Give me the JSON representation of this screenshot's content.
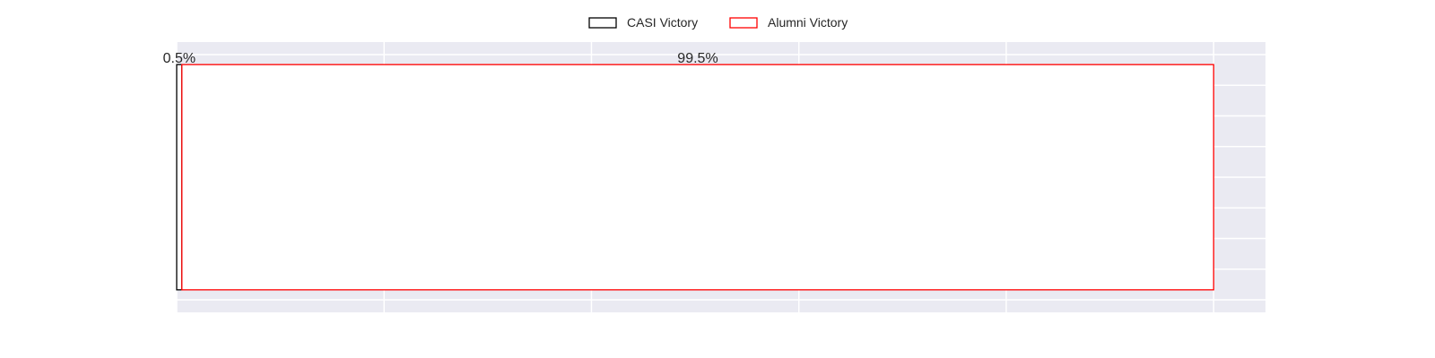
{
  "chart_data": {
    "type": "bar",
    "orientation": "horizontal",
    "stacked": true,
    "categories": [
      ""
    ],
    "series": [
      {
        "name": "CASI Victory",
        "values": [
          0.5
        ],
        "label": "0.5%",
        "edge_color": "#000000",
        "face_color": "#ffffff"
      },
      {
        "name": "Alumni Victory",
        "values": [
          99.5
        ],
        "label": "99.5%",
        "edge_color": "#ff0000",
        "face_color": "#ffffff"
      }
    ],
    "title": "",
    "xlabel": "",
    "ylabel": "",
    "xlim": [
      0,
      105
    ],
    "ylim": [
      -0.6,
      0.6
    ],
    "x_gridlines": [
      0,
      20,
      40,
      60,
      80,
      100
    ],
    "y_gridline_count": 9,
    "grid": true,
    "background_color": "#eaeaf2",
    "legend": {
      "placement": "top-center",
      "columns": 2
    }
  }
}
